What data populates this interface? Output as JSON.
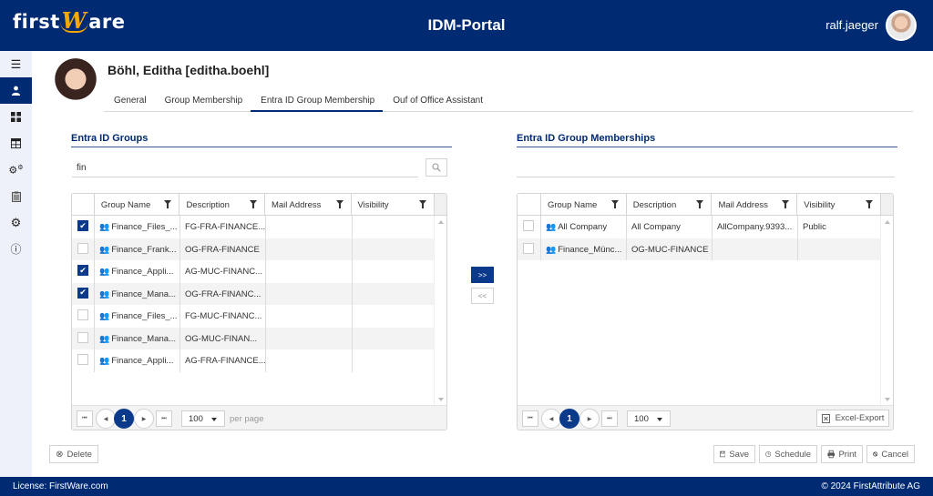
{
  "header": {
    "logo_prefix": "first",
    "logo_w": "W",
    "logo_suffix": "are",
    "title": "IDM-Portal",
    "username": "ralf.jaeger"
  },
  "sidebar": {
    "items": [
      {
        "icon": "menu-icon",
        "glyph": "☰",
        "active": false
      },
      {
        "icon": "user-icon",
        "glyph": "👤",
        "active": true
      },
      {
        "icon": "dashboard-icon",
        "glyph": "▦",
        "active": false
      },
      {
        "icon": "layout-icon",
        "glyph": "⊞",
        "active": false
      },
      {
        "icon": "cogs-icon",
        "glyph": "⚙",
        "active": false
      },
      {
        "icon": "clipboard-icon",
        "glyph": "📋",
        "active": false
      },
      {
        "icon": "settings-icon",
        "glyph": "✿",
        "active": false
      },
      {
        "icon": "info-icon",
        "glyph": "ⓘ",
        "active": false
      }
    ]
  },
  "profile": {
    "name": "Böhl, Editha [editha.boehl]"
  },
  "tabs": [
    {
      "label": "General",
      "active": false
    },
    {
      "label": "Group Membership",
      "active": false
    },
    {
      "label": "Entra ID Group Membership",
      "active": true
    },
    {
      "label": "Ouf of Office Assistant",
      "active": false
    }
  ],
  "left_panel": {
    "title": "Entra ID Groups",
    "search_value": "fin",
    "columns": [
      "Group Name",
      "Description",
      "Mail Address",
      "Visibility"
    ],
    "rows": [
      {
        "checked": true,
        "group_name": "Finance_Files_...",
        "description": "FG-FRA-FINANCE...",
        "mail": "",
        "visibility": ""
      },
      {
        "checked": false,
        "group_name": "Finance_Frank...",
        "description": "OG-FRA-FINANCE",
        "mail": "",
        "visibility": ""
      },
      {
        "checked": true,
        "group_name": "Finance_Appli...",
        "description": "AG-MUC-FINANC...",
        "mail": "",
        "visibility": ""
      },
      {
        "checked": true,
        "group_name": "Finance_Mana...",
        "description": "OG-FRA-FINANC...",
        "mail": "",
        "visibility": ""
      },
      {
        "checked": false,
        "group_name": "Finance_Files_...",
        "description": "FG-MUC-FINANC...",
        "mail": "",
        "visibility": ""
      },
      {
        "checked": false,
        "group_name": "Finance_Mana...",
        "description": "OG-MUC-FINAN...",
        "mail": "",
        "visibility": ""
      },
      {
        "checked": false,
        "group_name": "Finance_Appli...",
        "description": "AG-FRA-FINANCE...",
        "mail": "",
        "visibility": ""
      }
    ],
    "pager": {
      "current_page": "1",
      "page_size": "100",
      "per_page_label": "per page"
    }
  },
  "transfer": {
    "add_label": ">>",
    "remove_label": "<<"
  },
  "right_panel": {
    "title": "Entra ID Group Memberships",
    "columns": [
      "Group Name",
      "Description",
      "Mail Address",
      "Visibility"
    ],
    "rows": [
      {
        "checked": false,
        "group_name": "All Company",
        "description": "All Company",
        "mail": "AllCompany.9393...",
        "visibility": "Public"
      },
      {
        "checked": false,
        "group_name": "Finance_Münc...",
        "description": "OG-MUC-FINANCE",
        "mail": "",
        "visibility": ""
      }
    ],
    "pager": {
      "current_page": "1",
      "page_size": "100",
      "excel_label": "Excel-Export"
    }
  },
  "actions": {
    "delete": "Delete",
    "save": "Save",
    "schedule": "Schedule",
    "print": "Print",
    "cancel": "Cancel"
  },
  "footer": {
    "license": "License: FirstWare.com",
    "copyright": "© 2024 FirstAttribute AG"
  },
  "colors": {
    "brand": "#002b72",
    "accent": "#f5a800",
    "selected": "#0b3a8a"
  }
}
